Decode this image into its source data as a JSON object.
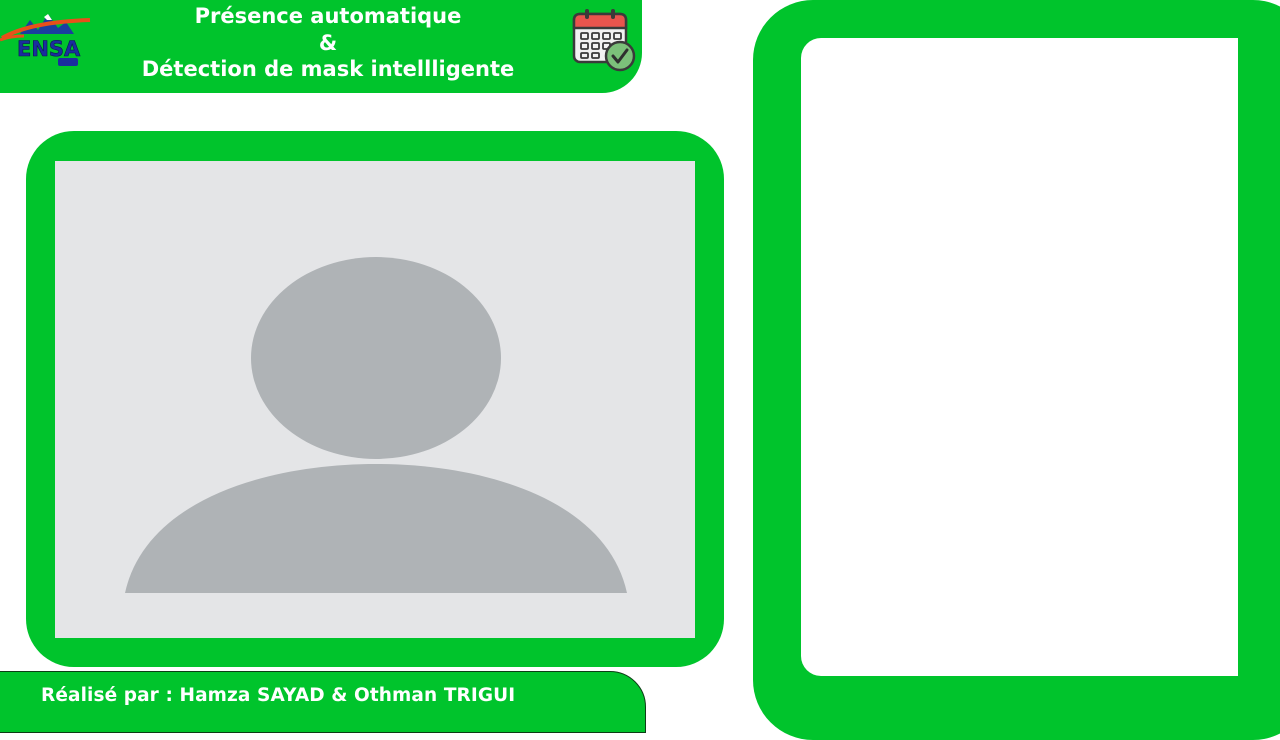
{
  "header": {
    "logo_text": "ENSA",
    "title_line1": "Présence automatique",
    "title_line2": "&",
    "title_line3": "Détection de mask intellligente",
    "calendar_icon": "calendar-check-icon"
  },
  "camera": {
    "placeholder_icon": "user-silhouette-icon"
  },
  "footer": {
    "credits": "Réalisé par : Hamza SAYAD & Othman TRIGUI"
  },
  "colors": {
    "accent_green": "#00c42c",
    "camera_background": "#e4e5e7",
    "silhouette": "#afb3b6",
    "panel": "#ffffff"
  }
}
